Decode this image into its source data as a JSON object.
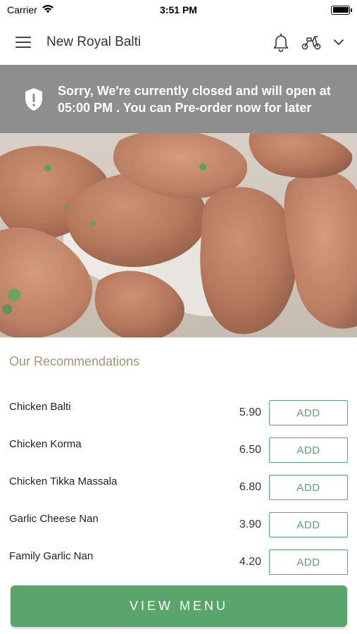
{
  "status_bar": {
    "carrier": "Carrier",
    "time": "3:51 PM"
  },
  "header": {
    "title": "New Royal Balti",
    "icons": [
      "menu-icon",
      "bell-icon",
      "scooter-icon",
      "chevron-down-icon"
    ]
  },
  "banner": {
    "message": "Sorry, We're currently closed and will open at 05:00 PM . You can Pre-order now for later",
    "icon": "shield-alert-icon",
    "background": "#8e8e8e"
  },
  "hero": {
    "description_icon": "food-photo"
  },
  "recommendations": {
    "title": "Our Recommendations",
    "items": [
      {
        "name": "Chicken Balti",
        "price": "5.90",
        "action": "ADD"
      },
      {
        "name": "Chicken Korma",
        "price": "6.50",
        "action": "ADD"
      },
      {
        "name": "Chicken Tikka Massala",
        "price": "6.80",
        "action": "ADD"
      },
      {
        "name": "Garlic Cheese Nan",
        "price": "3.90",
        "action": "ADD"
      },
      {
        "name": "Family Garlic Nan",
        "price": "4.20",
        "action": "ADD"
      }
    ]
  },
  "footer": {
    "view_menu_label": "VIEW MENU"
  },
  "colors": {
    "accent": "#5aa56c",
    "section_title": "#a89471"
  }
}
